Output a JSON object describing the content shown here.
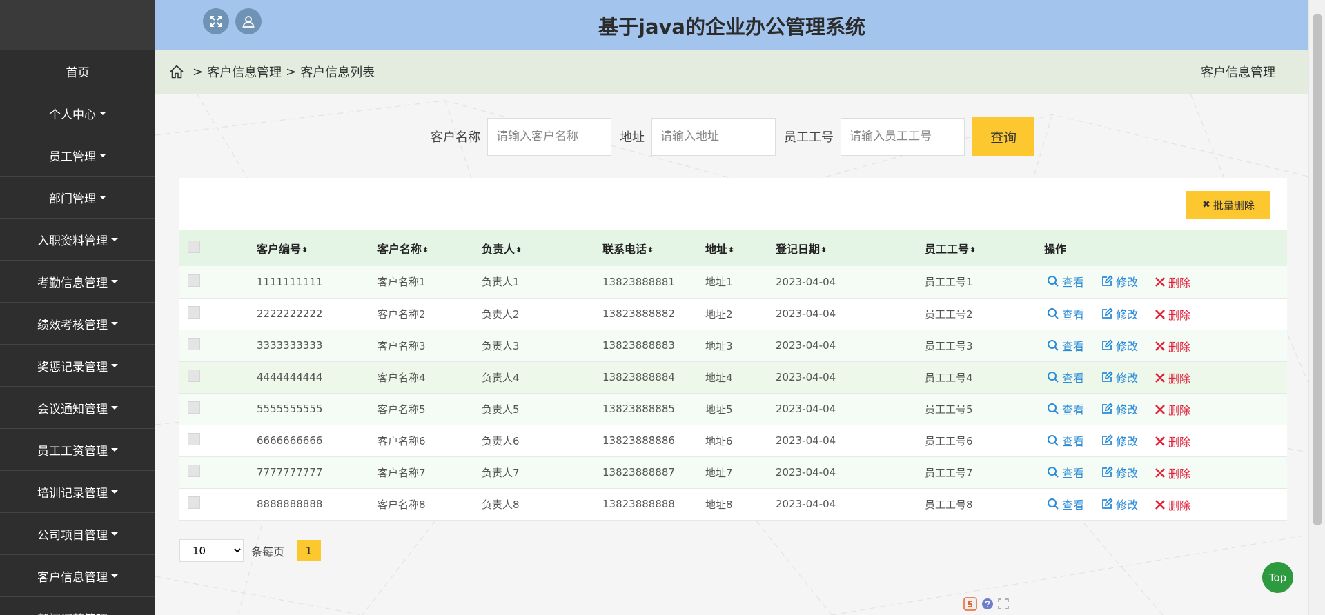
{
  "header": {
    "title": "基于java的企业办公管理系统"
  },
  "sidebar": {
    "items": [
      {
        "label": "首页",
        "has_caret": false
      },
      {
        "label": "个人中心",
        "has_caret": true
      },
      {
        "label": "员工管理",
        "has_caret": true
      },
      {
        "label": "部门管理",
        "has_caret": true
      },
      {
        "label": "入职资料管理",
        "has_caret": true
      },
      {
        "label": "考勤信息管理",
        "has_caret": true
      },
      {
        "label": "绩效考核管理",
        "has_caret": true
      },
      {
        "label": "奖惩记录管理",
        "has_caret": true
      },
      {
        "label": "会议通知管理",
        "has_caret": true
      },
      {
        "label": "员工工资管理",
        "has_caret": true
      },
      {
        "label": "培训记录管理",
        "has_caret": true
      },
      {
        "label": "公司项目管理",
        "has_caret": true
      },
      {
        "label": "客户信息管理",
        "has_caret": true
      },
      {
        "label": "部门调整管理",
        "has_caret": true
      }
    ]
  },
  "breadcrumb": {
    "sep": ">",
    "level1": "客户信息管理",
    "level2": "客户信息列表",
    "right_title": "客户信息管理"
  },
  "search": {
    "customer_name_label": "客户名称",
    "customer_name_placeholder": "请输入客户名称",
    "address_label": "地址",
    "address_placeholder": "请输入地址",
    "employee_no_label": "员工工号",
    "employee_no_placeholder": "请输入员工工号",
    "query_button": "查询"
  },
  "toolbar": {
    "batch_delete_label": "批量删除"
  },
  "table": {
    "columns": [
      "客户编号",
      "客户名称",
      "负责人",
      "联系电话",
      "地址",
      "登记日期",
      "员工工号",
      "操作"
    ],
    "rows": [
      [
        "1111111111",
        "客户名称1",
        "负责人1",
        "13823888881",
        "地址1",
        "2023-04-04",
        "员工工号1"
      ],
      [
        "2222222222",
        "客户名称2",
        "负责人2",
        "13823888882",
        "地址2",
        "2023-04-04",
        "员工工号2"
      ],
      [
        "3333333333",
        "客户名称3",
        "负责人3",
        "13823888883",
        "地址3",
        "2023-04-04",
        "员工工号3"
      ],
      [
        "4444444444",
        "客户名称4",
        "负责人4",
        "13823888884",
        "地址4",
        "2023-04-04",
        "员工工号4"
      ],
      [
        "5555555555",
        "客户名称5",
        "负责人5",
        "13823888885",
        "地址5",
        "2023-04-04",
        "员工工号5"
      ],
      [
        "6666666666",
        "客户名称6",
        "负责人6",
        "13823888886",
        "地址6",
        "2023-04-04",
        "员工工号6"
      ],
      [
        "7777777777",
        "客户名称7",
        "负责人7",
        "13823888887",
        "地址7",
        "2023-04-04",
        "员工工号7"
      ],
      [
        "8888888888",
        "客户名称8",
        "负责人8",
        "13823888888",
        "地址8",
        "2023-04-04",
        "员工工号8"
      ]
    ],
    "actions": {
      "view": "查看",
      "edit": "修改",
      "delete": "删除"
    },
    "sort_glyph": "⬍",
    "highlighted_row": 3
  },
  "pagination": {
    "page_size": "10",
    "per_page_label": "条每页",
    "current_page": "1"
  },
  "top_button": "Top",
  "colors": {
    "accent": "#fdc72f",
    "sidebar": "#2e2e2e",
    "header": "#a3c4ec",
    "link_blue": "#2a8bd8",
    "delete_red": "#e0243b",
    "top_green": "#2d9a3f"
  }
}
